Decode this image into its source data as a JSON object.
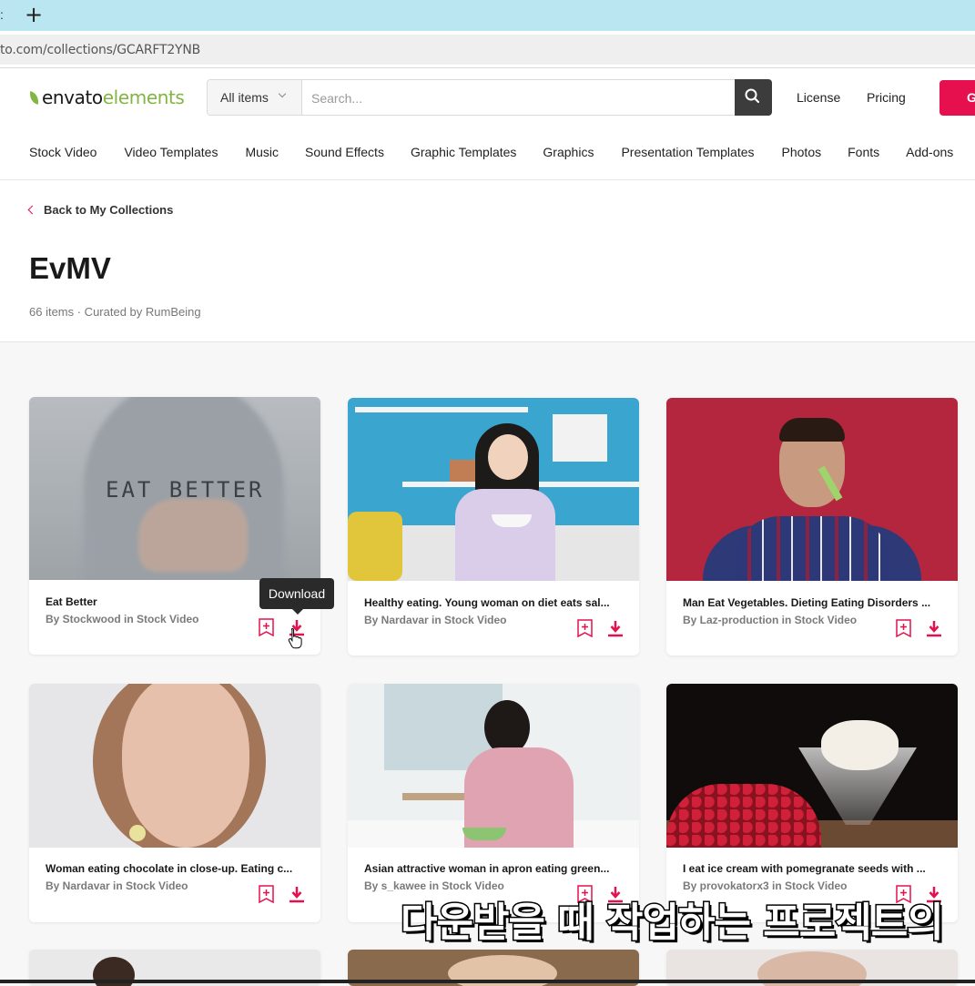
{
  "browser": {
    "new_tab_symbol": "+",
    "url": "to.com/collections/GCARFT2YNB"
  },
  "header": {
    "logo_part1": "envato",
    "logo_part2": "elements",
    "search_category": "All items",
    "search_placeholder": "Search...",
    "links": [
      "License",
      "Pricing"
    ],
    "cta_label": "G"
  },
  "nav": [
    "Stock Video",
    "Video Templates",
    "Music",
    "Sound Effects",
    "Graphic Templates",
    "Graphics",
    "Presentation Templates",
    "Photos",
    "Fonts",
    "Add-ons"
  ],
  "collection": {
    "back_label": "Back to My Collections",
    "title": "EvMV",
    "meta": "66 items · Curated by RumBeing"
  },
  "tooltip": "Download",
  "cards": [
    {
      "title": "Eat Better",
      "by": "By Stockwood in Stock Video",
      "thumb_text": "EAT BETTER"
    },
    {
      "title": "Healthy eating. Young woman on diet eats sal...",
      "by": "By Nardavar in Stock Video"
    },
    {
      "title": "Man Eat Vegetables. Dieting Eating Disorders ...",
      "by": "By Laz-production in Stock Video"
    },
    {
      "title": "Woman eating chocolate in close-up. Eating c...",
      "by": "By Nardavar in Stock Video"
    },
    {
      "title": "Asian attractive woman in apron eating green...",
      "by": "By s_kawee in Stock Video"
    },
    {
      "title": "I eat ice cream with pomegranate seeds with ...",
      "by": "By provokatorx3 in Stock Video"
    }
  ],
  "overlay_subtitle": "다운받을 때 작업하는 프로젝트의",
  "colors": {
    "accent": "#e6104e",
    "brand_green": "#82b541"
  }
}
